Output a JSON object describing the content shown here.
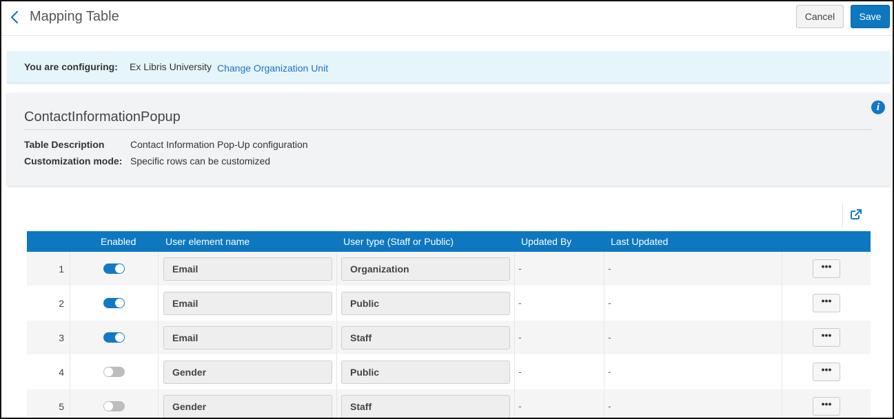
{
  "header": {
    "title": "Mapping Table",
    "cancel_label": "Cancel",
    "save_label": "Save"
  },
  "config": {
    "label": "You are configuring:",
    "org": "Ex Libris University",
    "change_link": "Change Organization Unit"
  },
  "description": {
    "table_name": "ContactInformationPopup",
    "table_description_label": "Table Description",
    "table_description": "Contact Information Pop-Up configuration",
    "customization_label": "Customization mode:",
    "customization_value": "Specific rows can be customized"
  },
  "table": {
    "columns": {
      "enabled": "Enabled",
      "element": "User element name",
      "user_type": "User type (Staff or Public)",
      "updated_by": "Updated By",
      "last_updated": "Last Updated"
    },
    "rows": [
      {
        "num": "1",
        "enabled": true,
        "element": "Email",
        "user_type": "Organization",
        "updated_by": "-",
        "last_updated": "-",
        "actions": "•••"
      },
      {
        "num": "2",
        "enabled": true,
        "element": "Email",
        "user_type": "Public",
        "updated_by": "-",
        "last_updated": "-",
        "actions": "•••"
      },
      {
        "num": "3",
        "enabled": true,
        "element": "Email",
        "user_type": "Staff",
        "updated_by": "-",
        "last_updated": "-",
        "actions": "•••"
      },
      {
        "num": "4",
        "enabled": false,
        "element": "Gender",
        "user_type": "Public",
        "updated_by": "-",
        "last_updated": "-",
        "actions": "•••"
      },
      {
        "num": "5",
        "enabled": false,
        "element": "Gender",
        "user_type": "Staff",
        "updated_by": "-",
        "last_updated": "-",
        "actions": "•••"
      }
    ]
  },
  "icons": {
    "back": "chevron-left-icon",
    "info": "info-icon",
    "export": "export-icon"
  },
  "colors": {
    "accent": "#0d77c0",
    "config_bg": "#e6f5fb",
    "panel_bg": "#f1f3f4"
  }
}
